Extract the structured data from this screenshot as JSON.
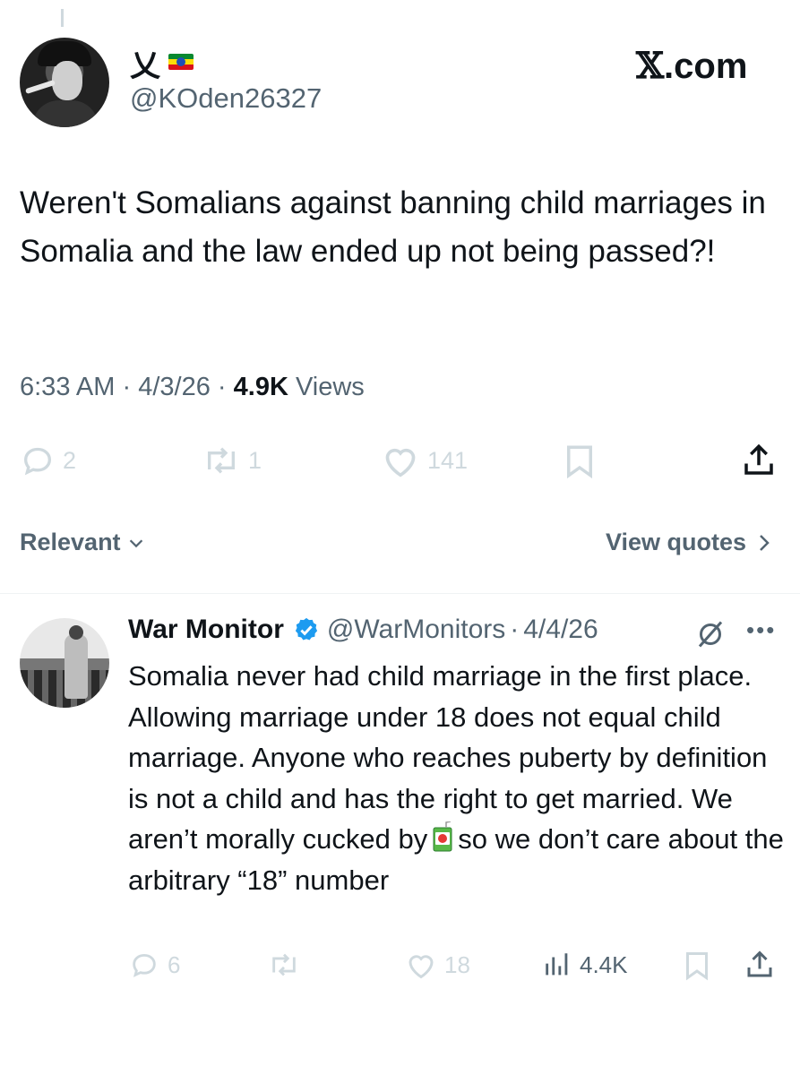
{
  "brand": {
    "logo": "𝕏",
    "text": ".com"
  },
  "original_tweet": {
    "display_name": "乂",
    "flag_icon": "ethiopian-flag-icon",
    "handle": "@KOden26327",
    "text": "Weren't Somalians against banning child marriages in Somalia and the law ended up not being passed?!",
    "time": "6:33 AM",
    "date": "4/3/26",
    "views_count": "4.9K",
    "views_label": "Views",
    "dot": "·",
    "replies": "2",
    "reposts": "1",
    "likes": "141",
    "colors": {
      "muted": "#536471",
      "faded_icons": "#cfd9de"
    }
  },
  "filters": {
    "sort_label": "Relevant",
    "quotes_label": "View quotes"
  },
  "reply": {
    "display_name": "War Monitor",
    "verified_icon": "verified-badge-icon",
    "handle": "@WarMonitors",
    "dot": "·",
    "date": "4/4/26",
    "text_before_emoji": "Somalia never had child marriage in the first place. Allowing marriage under 18 does not equal child marriage. Anyone who reaches puberty by definition is not a child and has the right to get married. We aren’t morally cucked by",
    "emoji": "juice-box-emoji",
    "text_after_emoji": "so we don’t care about the arbitrary “18” number",
    "replies": "6",
    "reposts": "",
    "likes": "18",
    "views": "4.4K",
    "colors": {
      "verified": "#1d9bf0"
    }
  }
}
